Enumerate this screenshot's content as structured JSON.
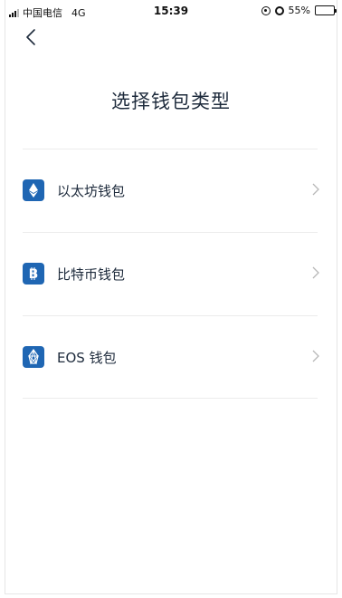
{
  "status_bar": {
    "carrier": "中国电信",
    "network": "4G",
    "time": "15:39",
    "battery_percent": "55%",
    "battery_level": 0.55
  },
  "page": {
    "title": "选择钱包类型"
  },
  "wallets": [
    {
      "label": "以太坊钱包",
      "icon": "ethereum-icon"
    },
    {
      "label": "比特币钱包",
      "icon": "bitcoin-icon"
    },
    {
      "label": "EOS 钱包",
      "icon": "eos-icon"
    }
  ],
  "colors": {
    "accent": "#1f66b3",
    "text": "#1e2b3c",
    "divider": "#ececec",
    "chevron": "#b8b8b8"
  }
}
